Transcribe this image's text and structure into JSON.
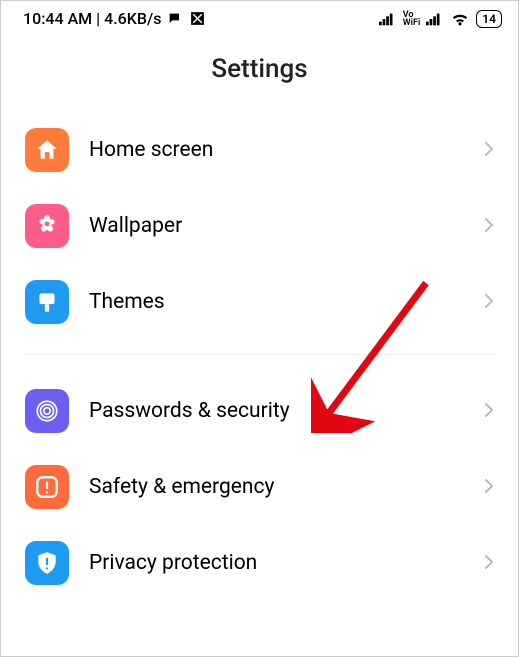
{
  "statusBar": {
    "time": "10:44 AM",
    "speed": "4.6KB/s",
    "voWifi": "Vo\nWiFi",
    "battery": "14"
  },
  "title": "Settings",
  "group1": [
    {
      "label": "Home screen",
      "iconBg": "#FF7B3A",
      "icon": "home"
    },
    {
      "label": "Wallpaper",
      "iconBg": "#FF5C8A",
      "icon": "flower"
    },
    {
      "label": "Themes",
      "iconBg": "#1E9BF0",
      "icon": "brush"
    }
  ],
  "group2": [
    {
      "label": "Passwords & security",
      "iconBg": "#6B5EF0",
      "icon": "fingerprint"
    },
    {
      "label": "Safety & emergency",
      "iconBg": "#FF6B3D",
      "icon": "alert"
    },
    {
      "label": "Privacy protection",
      "iconBg": "#1E9BF0",
      "icon": "shield"
    }
  ]
}
